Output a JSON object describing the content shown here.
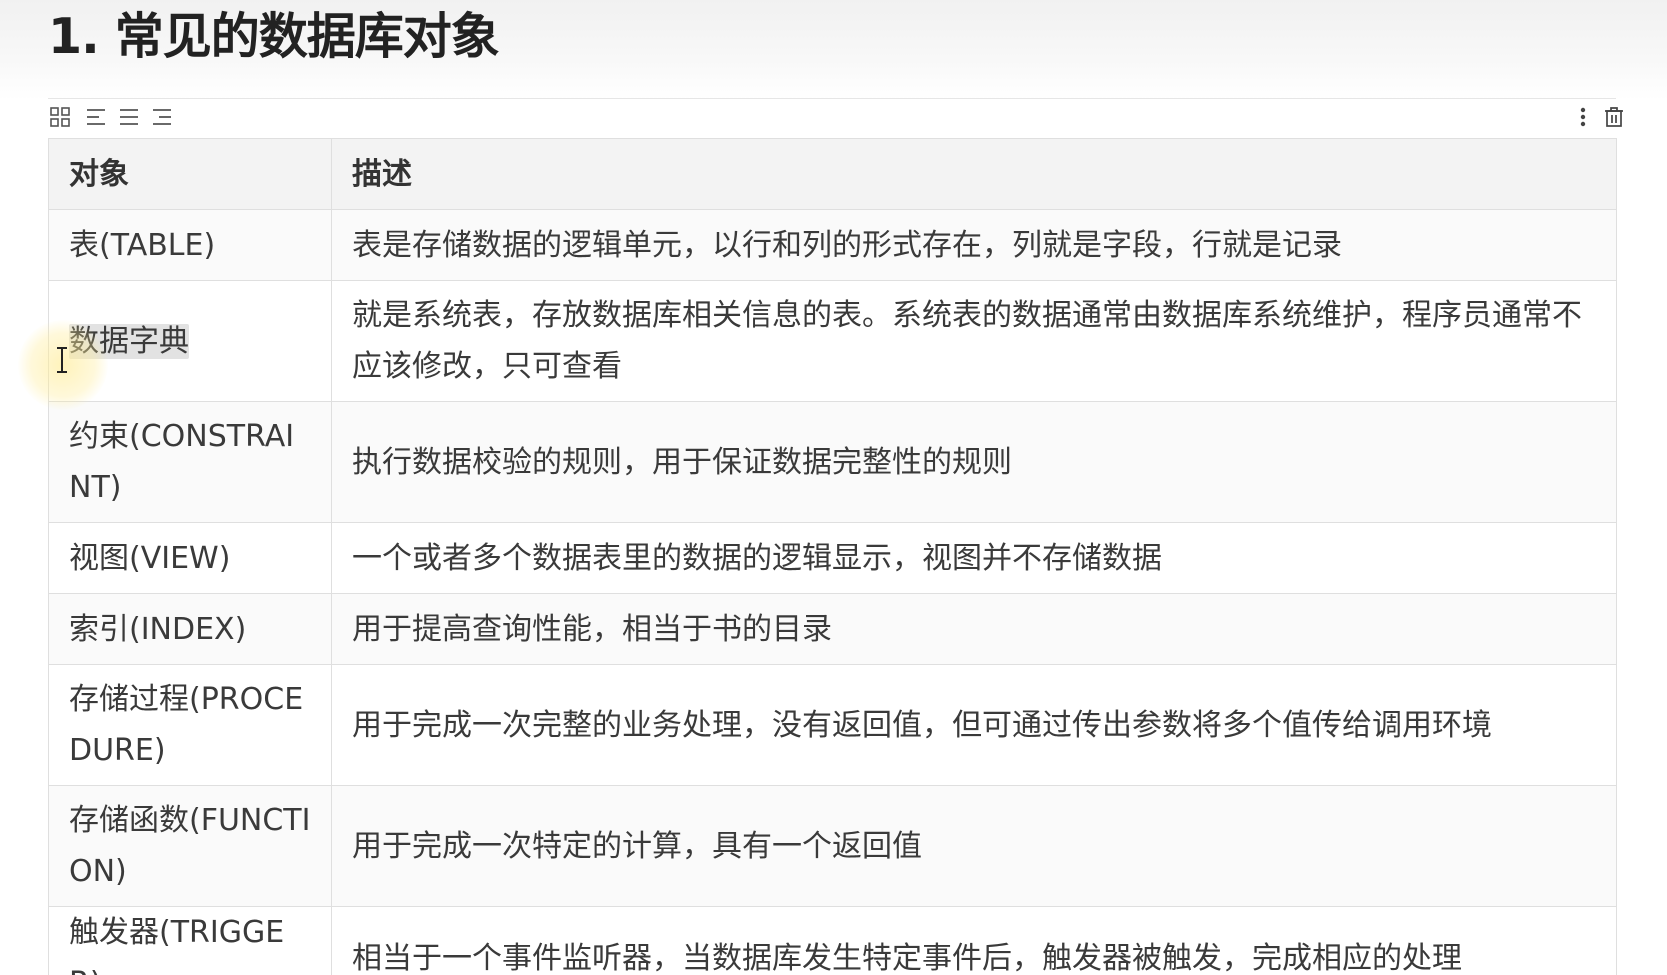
{
  "page": {
    "title": "1. 常见的数据库对象"
  },
  "toolbar": {
    "left_icons": [
      "grid-icon",
      "align-left-icon",
      "align-center-icon",
      "align-right-icon"
    ],
    "right_icons": [
      "more-vertical-icon",
      "trash-icon"
    ]
  },
  "table": {
    "headers": [
      "对象",
      "描述"
    ],
    "rows": [
      {
        "object": "表(TABLE)",
        "description": "表是存储数据的逻辑单元，以行和列的形式存在，列就是字段，行就是记录"
      },
      {
        "object": "数据字典",
        "description": "就是系统表，存放数据库相关信息的表。系统表的数据通常由数据库系统维护，程序员通常不应该修改，只可查看"
      },
      {
        "object": "约束(CONSTRAINT)",
        "description": "执行数据校验的规则，用于保证数据完整性的规则"
      },
      {
        "object": "视图(VIEW)",
        "description": "一个或者多个数据表里的数据的逻辑显示，视图并不存储数据"
      },
      {
        "object": "索引(INDEX)",
        "description": "用于提高查询性能，相当于书的目录"
      },
      {
        "object": "存储过程(PROCEDURE)",
        "description": "用于完成一次完整的业务处理，没有返回值，但可通过传出参数将多个值传给调用环境"
      },
      {
        "object": "存储函数(FUNCTION)",
        "description": "用于完成一次特定的计算，具有一个返回值"
      },
      {
        "object": "触发器(TRIGGER)",
        "description": "相当于一个事件监听器，当数据库发生特定事件后，触发器被触发，完成相应的处理"
      }
    ]
  }
}
